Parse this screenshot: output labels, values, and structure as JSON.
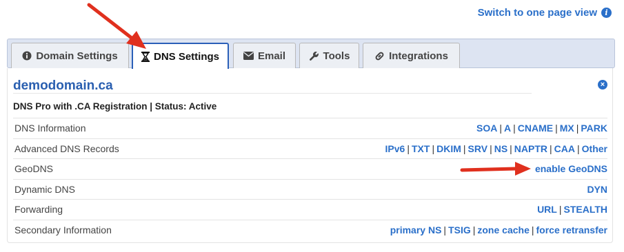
{
  "top_link": {
    "label": "Switch to one page view",
    "info_icon": "i"
  },
  "tabs": [
    {
      "label": "Domain Settings",
      "icon": "info-circle-icon",
      "active": false
    },
    {
      "label": "DNS Settings",
      "icon": "hourglass-icon",
      "active": true
    },
    {
      "label": "Email",
      "icon": "envelope-icon",
      "active": false
    },
    {
      "label": "Tools",
      "icon": "wrench-icon",
      "active": false
    },
    {
      "label": "Integrations",
      "icon": "link-icon",
      "active": false
    }
  ],
  "panel": {
    "domain": "demodomain.ca",
    "close_icon": "×",
    "subtitle": "DNS Pro with .CA Registration | Status: Active",
    "rows": [
      {
        "label": "DNS Information",
        "links": [
          "SOA",
          "A",
          "CNAME",
          "MX",
          "PARK"
        ]
      },
      {
        "label": "Advanced DNS Records",
        "links": [
          "IPv6",
          "TXT",
          "DKIM",
          "SRV",
          "NS",
          "NAPTR",
          "CAA",
          "Other"
        ]
      },
      {
        "label": "GeoDNS",
        "links": [
          "enable GeoDNS"
        ]
      },
      {
        "label": "Dynamic DNS",
        "links": [
          "DYN"
        ]
      },
      {
        "label": "Forwarding",
        "links": [
          "URL",
          "STEALTH"
        ]
      },
      {
        "label": "Secondary Information",
        "links": [
          "primary NS",
          "TSIG",
          "zone cache",
          "force retransfer"
        ]
      }
    ]
  },
  "colors": {
    "link": "#2a6fc9",
    "title": "#2a5fb0",
    "active_tab_border": "#2a5fb8",
    "arrow": "#e0301e"
  }
}
